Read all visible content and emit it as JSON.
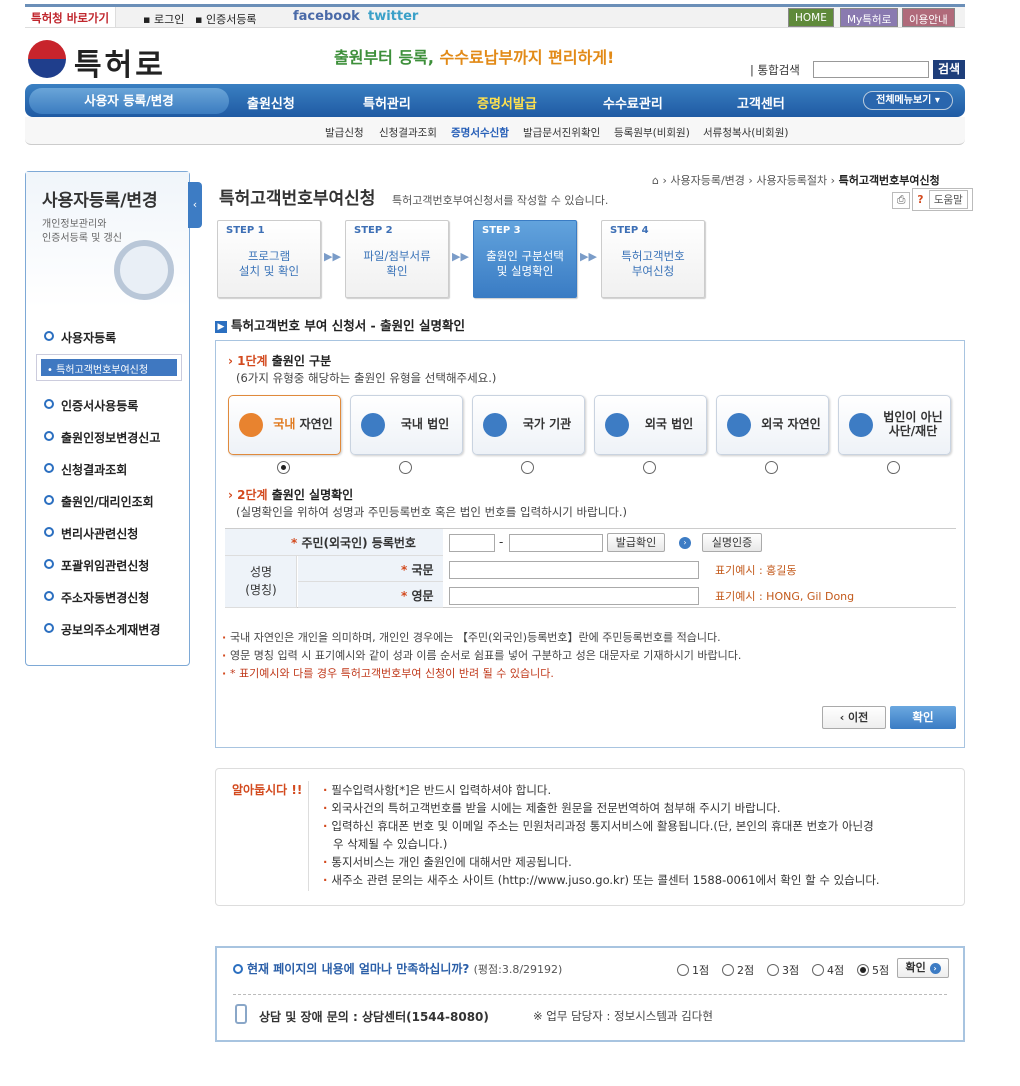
{
  "topbar": {
    "quick": "특허청 바로가기",
    "login": "로그인",
    "cert": "인증서등록",
    "facebook": "facebook",
    "twitter": "twitter",
    "home": "HOME",
    "my": "My특허로",
    "guide": "이용안내",
    "colors": {
      "home": "#5f8a3a",
      "my": "#8a7ab0",
      "guide": "#b06a7a"
    }
  },
  "header": {
    "logo": "특허로",
    "slogan_a": "출원부터 등록, ",
    "slogan_b": "수수료납부까지 편리하게!",
    "search_label": "| 통합검색",
    "search_btn": "검색"
  },
  "nav": {
    "items": [
      "사용자 등록/변경",
      "출원신청",
      "특허관리",
      "증명서발급",
      "수수료관리",
      "고객센터"
    ],
    "all_menu": "전체메뉴보기",
    "sub": [
      "발급신청",
      "신청결과조회",
      "증명서수신함",
      "발급문서진위확인",
      "등록원부(비회원)",
      "서류청복사(비회원)"
    ]
  },
  "sidebar": {
    "title": "사용자등록/변경",
    "desc1": "개인정보관리와",
    "desc2": "인증서등록 및 갱신",
    "items": [
      "사용자등록",
      "인증서사용등록",
      "출원인정보변경신고",
      "신청결과조회",
      "출원인/대리인조회",
      "변리사관련신청",
      "포괄위임관련신청",
      "주소자동변경신청",
      "공보의주소게재변경"
    ],
    "sub_selected": "특허고객번호부여신청"
  },
  "page": {
    "title": "특허고객번호부여신청",
    "subtitle": "특허고객번호부여신청서를 작성할 수 있습니다.",
    "crumb1": "사용자등록/변경",
    "crumb2": "사용자등록절차",
    "crumb3": "특허고객번호부여신청",
    "help": "도움말"
  },
  "steps": [
    {
      "num": "STEP 1",
      "l1": "프로그램",
      "l2": "설치 및 확인"
    },
    {
      "num": "STEP 2",
      "l1": "파일/첨부서류",
      "l2": "확인"
    },
    {
      "num": "STEP 3",
      "l1": "출원인 구분선택",
      "l2": "및 실명확인"
    },
    {
      "num": "STEP 4",
      "l1": "특허고객번호",
      "l2": "부여신청"
    }
  ],
  "section_title": "특허고객번호 부여 신청서 - 출원인 실명확인",
  "stage1": {
    "num": "1단계",
    "title": " 출원인 구분",
    "note": "(6가지 유형중 해당하는 출원인 유형을 선택해주세요.)",
    "types": [
      {
        "a": "국내",
        "b": " 자연인"
      },
      {
        "a": "",
        "b": "국내 법인"
      },
      {
        "a": "",
        "b": "국가 기관"
      },
      {
        "a": "",
        "b": "외국 법인"
      },
      {
        "a": "",
        "b": "외국 자연인"
      },
      {
        "a": "법인이 아닌",
        "b": "사단/재단"
      }
    ]
  },
  "stage2": {
    "num": "2단계",
    "title": " 출원인 실명확인",
    "note": "(실명확인을 위하여 성명과 주민등록번호 혹은 법인 번호를 입력하시기 바랍니다.)",
    "rrn_label": "주민(외국인) 등록번호",
    "dash": "-",
    "issue_btn": "발급확인",
    "verify_btn": "실명인증",
    "name1": "성명",
    "name2": "(명칭)",
    "kor": "국문",
    "eng": "영문",
    "ex_kor": "표기예시 : 홍길동",
    "ex_eng": "표기예시 : HONG, Gil Dong"
  },
  "bullets": [
    "국내 자연인은 개인을 의미하며, 개인인 경우에는 【주민(외국인)등록번호】란에 주민등록번호를 적습니다.",
    "영문 명칭 입력 시 표기예시와 같이 성과 이름 순서로 쉼표를 넣어 구분하고 성은 대문자로 기재하시기 바랍니다.",
    "* 표기예시와 다를 경우 특허고객번호부여 신청이 반려 될 수 있습니다."
  ],
  "buttons": {
    "prev": "‹ 이전",
    "ok": "확인"
  },
  "notice": {
    "title": "알아둡시다 !!",
    "lines": [
      "필수입력사항[*]은 반드시 입력하셔야 합니다.",
      "외국사건의 특허고객번호를 받을 시에는 제출한 원문을 전문번역하여 첨부해 주시기 바랍니다.",
      "입력하신 휴대폰 번호 및 이메일 주소는 민원처리과정 통지서비스에 활용됩니다.(단, 본인의 휴대폰 번호가 아닌경",
      "우 삭제될 수 있습니다.)",
      "통지서비스는 개인 출원인에 대해서만 제공됩니다.",
      "새주소 관련 문의는 새주소 사이트 (http://www.juso.go.kr) 또는 콜센터 1588-0061에서 확인 할 수 있습니다."
    ]
  },
  "survey": {
    "question": "현재 페이지의 내용에 얼마나 만족하십니까?",
    "score": "(평점:3.8/29192)",
    "options": [
      "1점",
      "2점",
      "3점",
      "4점",
      "5점"
    ],
    "selected": 5,
    "ok": "확인",
    "contact": "상담 및 장애 문의 : 상담센터(1544-8080)",
    "manager": "※ 업무 담당자 : 정보시스템과 김다현"
  }
}
